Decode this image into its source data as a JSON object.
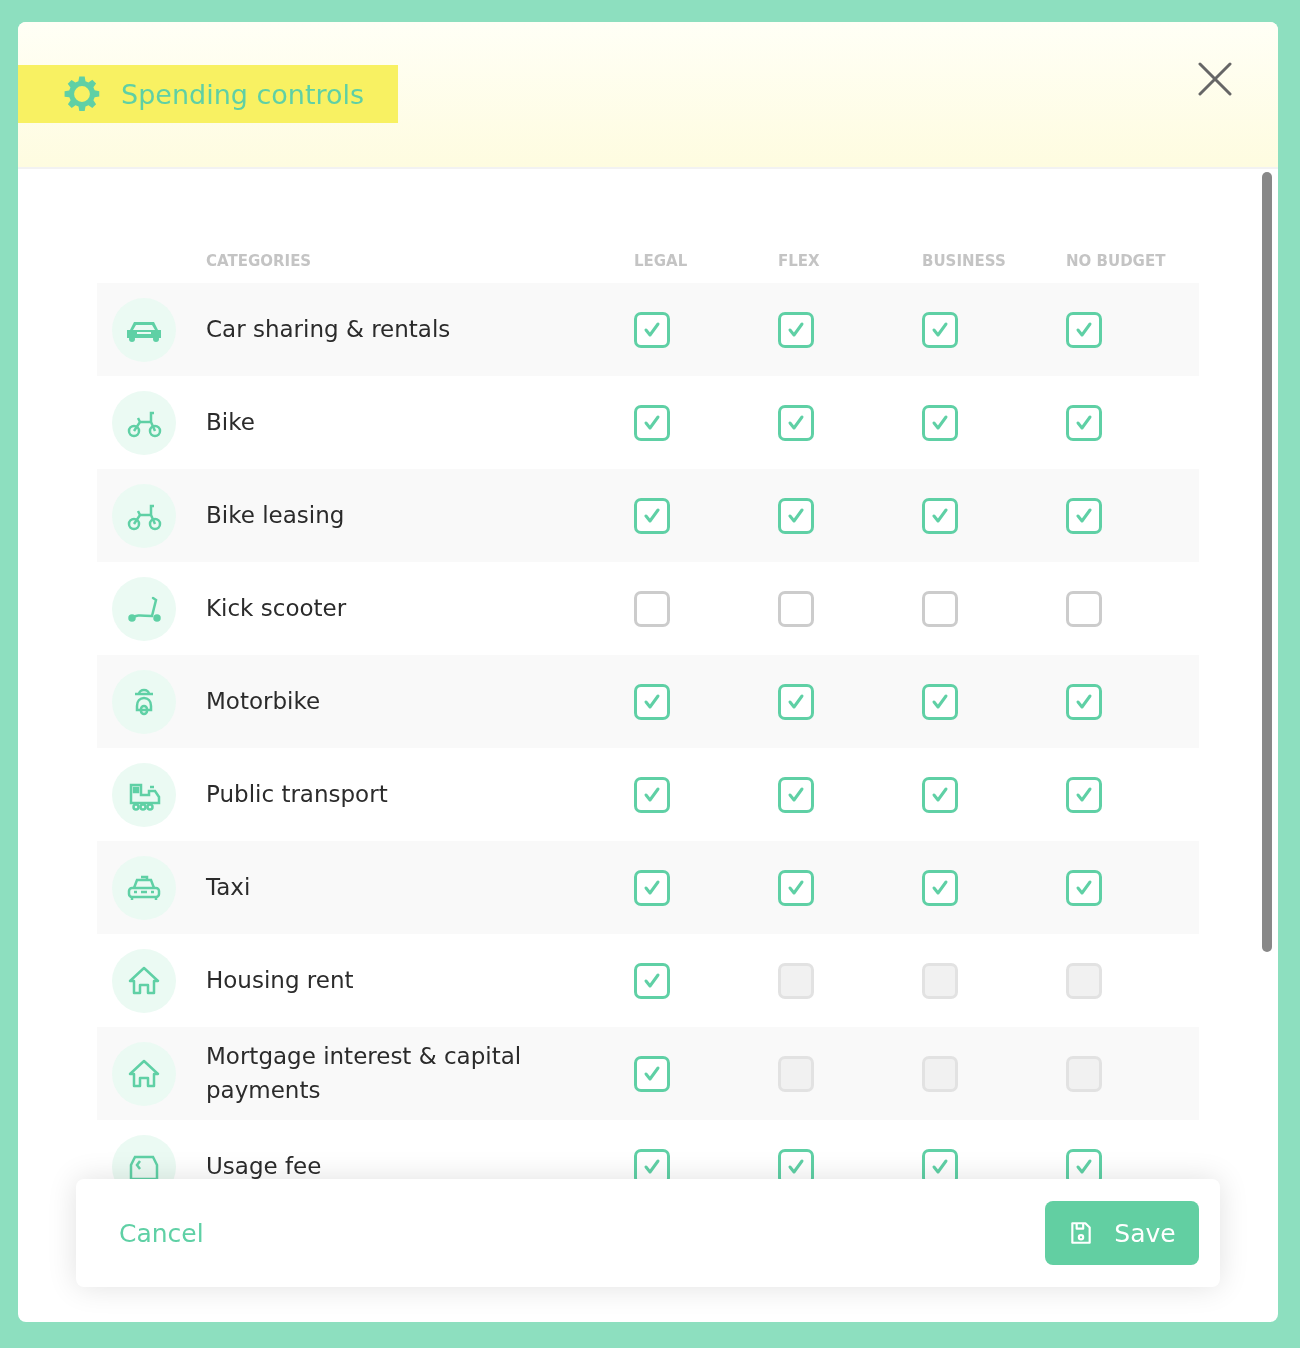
{
  "dialog": {
    "title": "Spending controls",
    "columns": [
      "CATEGORIES",
      "LEGAL",
      "FLEX",
      "BUSINESS",
      "NO BUDGET"
    ],
    "rows": [
      {
        "kind": "car",
        "label": "Car sharing & rentals",
        "checks": [
          {
            "checked": true,
            "disabled": false
          },
          {
            "checked": true,
            "disabled": false
          },
          {
            "checked": true,
            "disabled": false
          },
          {
            "checked": true,
            "disabled": false
          }
        ]
      },
      {
        "kind": "bike",
        "label": "Bike",
        "checks": [
          {
            "checked": true,
            "disabled": false
          },
          {
            "checked": true,
            "disabled": false
          },
          {
            "checked": true,
            "disabled": false
          },
          {
            "checked": true,
            "disabled": false
          }
        ]
      },
      {
        "kind": "bike",
        "label": "Bike leasing",
        "checks": [
          {
            "checked": true,
            "disabled": false
          },
          {
            "checked": true,
            "disabled": false
          },
          {
            "checked": true,
            "disabled": false
          },
          {
            "checked": true,
            "disabled": false
          }
        ]
      },
      {
        "kind": "scooter",
        "label": "Kick scooter",
        "checks": [
          {
            "checked": false,
            "disabled": false
          },
          {
            "checked": false,
            "disabled": false
          },
          {
            "checked": false,
            "disabled": false
          },
          {
            "checked": false,
            "disabled": false
          }
        ]
      },
      {
        "kind": "motorbike",
        "label": "Motorbike",
        "checks": [
          {
            "checked": true,
            "disabled": false
          },
          {
            "checked": true,
            "disabled": false
          },
          {
            "checked": true,
            "disabled": false
          },
          {
            "checked": true,
            "disabled": false
          }
        ]
      },
      {
        "kind": "train",
        "label": "Public transport",
        "checks": [
          {
            "checked": true,
            "disabled": false
          },
          {
            "checked": true,
            "disabled": false
          },
          {
            "checked": true,
            "disabled": false
          },
          {
            "checked": true,
            "disabled": false
          }
        ]
      },
      {
        "kind": "taxi",
        "label": "Taxi",
        "checks": [
          {
            "checked": true,
            "disabled": false
          },
          {
            "checked": true,
            "disabled": false
          },
          {
            "checked": true,
            "disabled": false
          },
          {
            "checked": true,
            "disabled": false
          }
        ]
      },
      {
        "kind": "house",
        "label": "Housing rent",
        "checks": [
          {
            "checked": true,
            "disabled": false
          },
          {
            "checked": false,
            "disabled": true
          },
          {
            "checked": false,
            "disabled": true
          },
          {
            "checked": false,
            "disabled": true
          }
        ]
      },
      {
        "kind": "house",
        "label": "Mortgage interest & capital payments",
        "checks": [
          {
            "checked": true,
            "disabled": false
          },
          {
            "checked": false,
            "disabled": true
          },
          {
            "checked": false,
            "disabled": true
          },
          {
            "checked": false,
            "disabled": true
          }
        ]
      },
      {
        "kind": "fee",
        "label": "Usage fee",
        "checks": [
          {
            "checked": true,
            "disabled": false
          },
          {
            "checked": true,
            "disabled": false
          },
          {
            "checked": true,
            "disabled": false
          },
          {
            "checked": true,
            "disabled": false
          }
        ]
      }
    ],
    "footer": {
      "cancel": "Cancel",
      "save": "Save"
    }
  }
}
